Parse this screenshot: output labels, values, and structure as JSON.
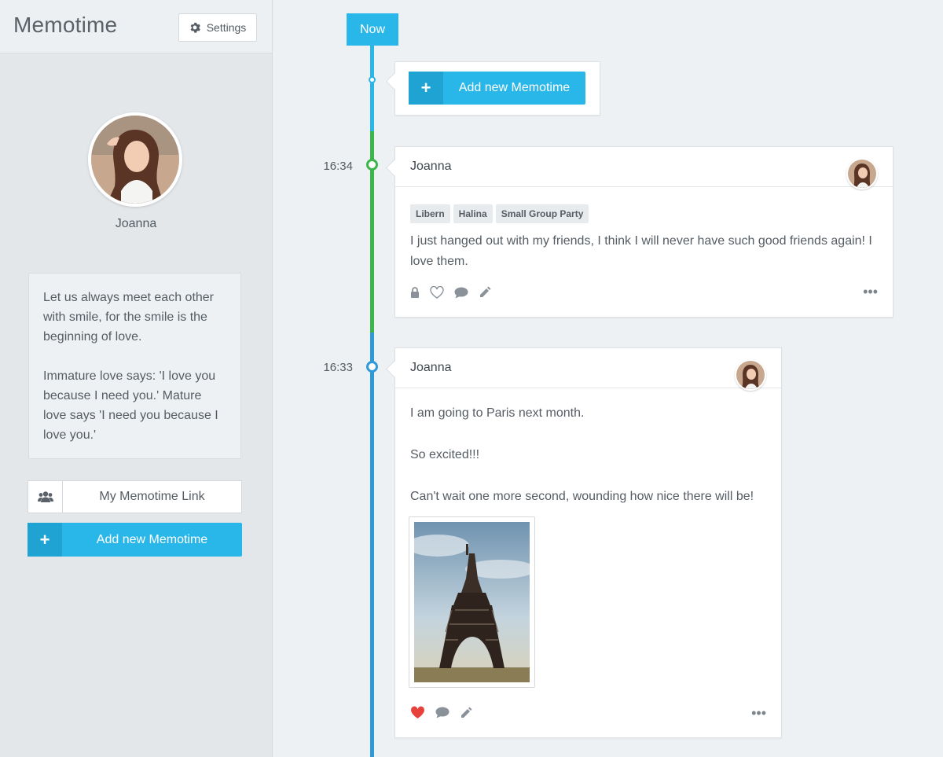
{
  "app": {
    "title": "Memotime"
  },
  "header": {
    "settings_label": "Settings"
  },
  "profile": {
    "name": "Joanna"
  },
  "quote": {
    "p1": "Let us always meet each other with smile, for the smile is the beginning of love.",
    "p2": "Immature love says: 'I love you because I need you.' Mature love says 'I need you because I love you.'"
  },
  "sidebar": {
    "link_label": "My Memotime Link",
    "add_label": "Add new Memotime"
  },
  "timeline": {
    "now_label": "Now",
    "add_label": "Add new Memotime",
    "posts": [
      {
        "time": "16:34",
        "author": "Joanna",
        "tags": [
          "Libern",
          "Halina",
          "Small Group Party"
        ],
        "text": "I just hanged out with my friends, I think I will never have such good friends again! I love them.",
        "more": "•••"
      },
      {
        "time": "16:33",
        "author": "Joanna",
        "lines": [
          "I am going to Paris next month.",
          "So excited!!!",
          "Can't wait one more second, wounding how nice there will be!"
        ],
        "more": "•••"
      }
    ]
  },
  "colors": {
    "accent": "#29b6e8",
    "green": "#3cb64a",
    "blue": "#2f9ad8",
    "heart": "#e8413c"
  }
}
